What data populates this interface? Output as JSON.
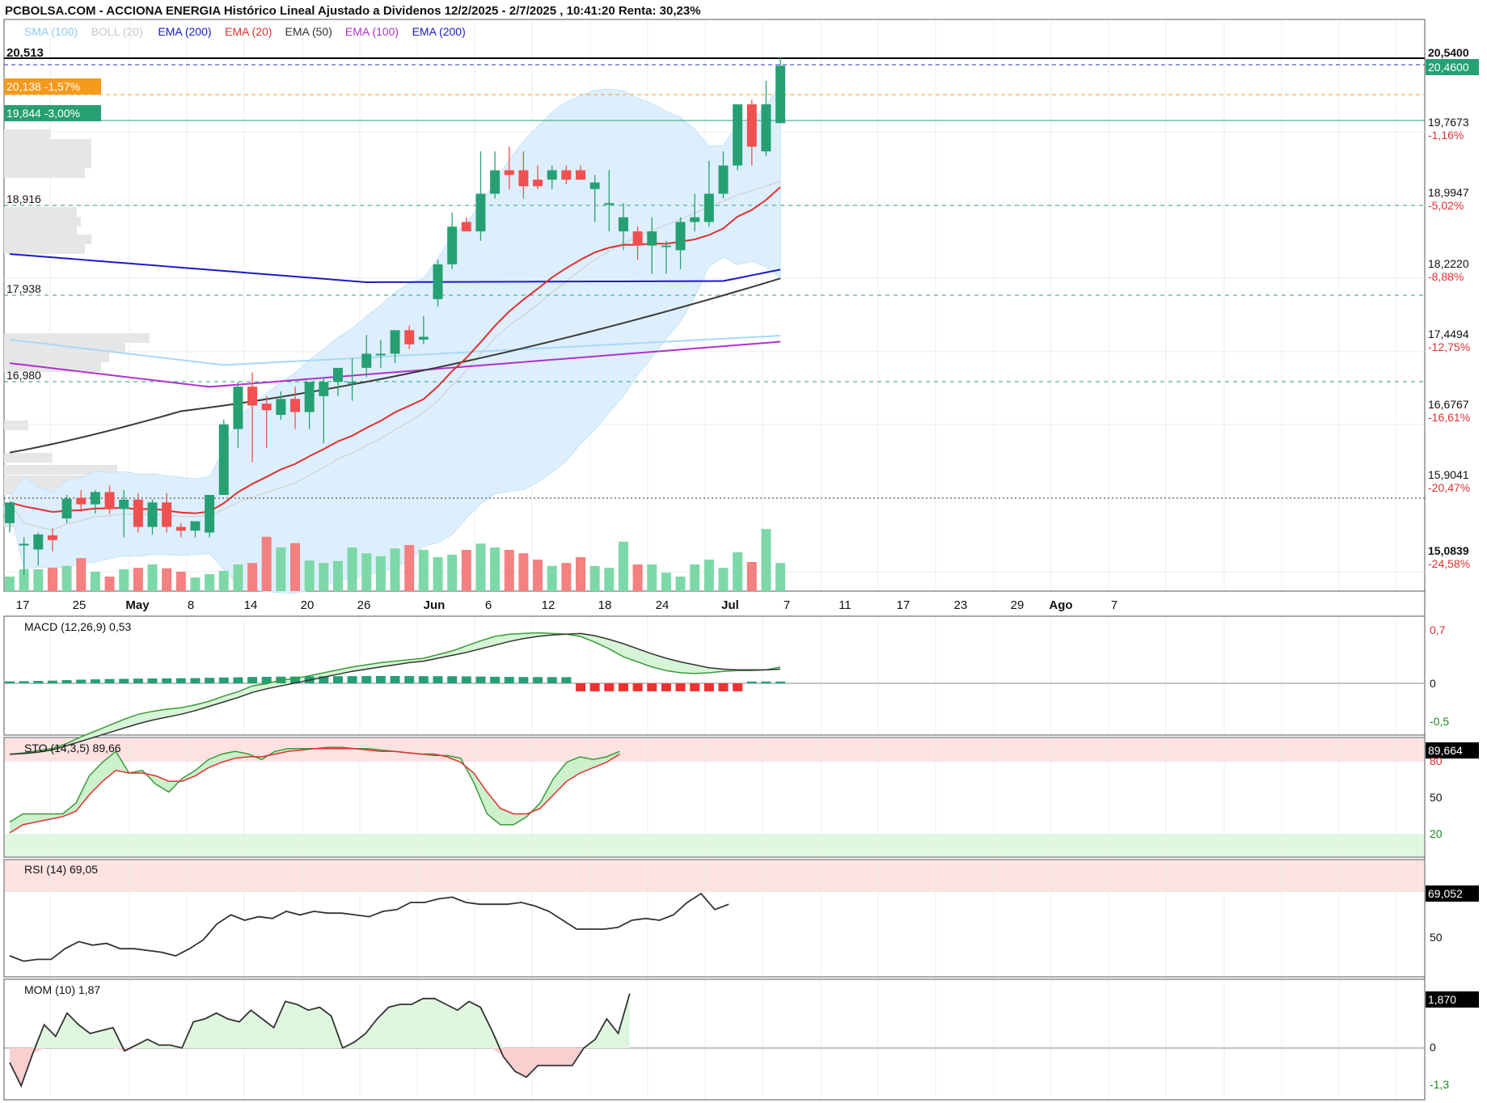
{
  "header": {
    "title": "PCBOLSA.COM - ACCIONA ENERGIA Histórico Lineal Ajustado a Dividenos 12/2/2025 - 2/7/2025 , 10:41:20 Renta: 30,23%",
    "legend": [
      {
        "label": "SMA (100)",
        "color": "#8fc9f0"
      },
      {
        "label": "BOLL (20)",
        "color": "#c8c8c8"
      },
      {
        "label": "EMA (200)",
        "color": "#1a1acc"
      },
      {
        "label": "EMA (20)",
        "color": "#e03030"
      },
      {
        "label": "EMA (50)",
        "color": "#333333"
      },
      {
        "label": "EMA (100)",
        "color": "#b030d0"
      },
      {
        "label": "EMA (200)",
        "color": "#1a1acc"
      }
    ]
  },
  "price_panel": {
    "max_label": "20,513",
    "badge_orange": "20,138 -1,57%",
    "badge_green": "19,844 -3,00%",
    "level_labels": [
      "18,916",
      "17,938",
      "16,980"
    ],
    "last_price": "20,4600",
    "axis_labels": [
      {
        "value": "20,5400",
        "pct": ""
      },
      {
        "value": "19,7673",
        "pct": "-1,16%"
      },
      {
        "value": "18,9947",
        "pct": "-5,02%"
      },
      {
        "value": "18,2220",
        "pct": "-8,88%"
      },
      {
        "value": "17,4494",
        "pct": "-12,75%"
      },
      {
        "value": "16,6767",
        "pct": "-16,61%"
      },
      {
        "value": "15,9041",
        "pct": "-20,47%"
      },
      {
        "value": "15,0839",
        "pct": "-24,58%"
      }
    ],
    "x_labels": [
      {
        "t": "17",
        "bold": false
      },
      {
        "t": "25",
        "bold": false
      },
      {
        "t": "May",
        "bold": true
      },
      {
        "t": "8",
        "bold": false
      },
      {
        "t": "14",
        "bold": false
      },
      {
        "t": "20",
        "bold": false
      },
      {
        "t": "26",
        "bold": false
      },
      {
        "t": "Jun",
        "bold": true
      },
      {
        "t": "6",
        "bold": false
      },
      {
        "t": "12",
        "bold": false
      },
      {
        "t": "18",
        "bold": false
      },
      {
        "t": "24",
        "bold": false
      },
      {
        "t": "Jul",
        "bold": true
      },
      {
        "t": "7",
        "bold": false
      },
      {
        "t": "11",
        "bold": false
      },
      {
        "t": "17",
        "bold": false
      },
      {
        "t": "23",
        "bold": false
      },
      {
        "t": "29",
        "bold": false
      },
      {
        "t": "Ago",
        "bold": true
      },
      {
        "t": "7",
        "bold": false
      }
    ]
  },
  "macd": {
    "label": "MACD (12,26,9)",
    "value": "0,53",
    "axis": [
      "0,7",
      "0",
      "-0,5"
    ]
  },
  "sto": {
    "label": "STO (14,3,5)",
    "value": "89,66",
    "last": "89,664",
    "axis": [
      "80",
      "50",
      "20"
    ]
  },
  "rsi": {
    "label": "RSI (14)",
    "value": "69,05",
    "last": "69,052",
    "axis": [
      "50"
    ]
  },
  "mom": {
    "label": "MOM (10)",
    "value": "1,87",
    "last": "1,870",
    "axis": [
      "0",
      "-1,3"
    ]
  },
  "colors": {
    "up": "#26a073",
    "down": "#f05050",
    "vol_up": "#7dd8a8",
    "vol_down": "#f48080"
  },
  "chart_data": {
    "type": "candlestick",
    "x": [
      "Apr 14",
      "Apr 15",
      "Apr 16",
      "Apr 17",
      "Apr 22",
      "Apr 23",
      "Apr 24",
      "Apr 25",
      "Apr 28",
      "Apr 29",
      "Apr 30",
      "May 2",
      "May 5",
      "May 6",
      "May 7",
      "May 8",
      "May 9",
      "May 12",
      "May 13",
      "May 14",
      "May 15",
      "May 16",
      "May 19",
      "May 20",
      "May 21",
      "May 22",
      "May 23",
      "May 26",
      "May 27",
      "May 28",
      "May 29",
      "May 30",
      "Jun 2",
      "Jun 3",
      "Jun 4",
      "Jun 5",
      "Jun 6",
      "Jun 9",
      "Jun 10",
      "Jun 11",
      "Jun 12",
      "Jun 13",
      "Jun 16",
      "Jun 17",
      "Jun 18",
      "Jun 19",
      "Jun 20",
      "Jun 23",
      "Jun 24",
      "Jun 25",
      "Jun 26",
      "Jun 27",
      "Jun 30",
      "Jul 1",
      "Jul 2"
    ],
    "open": [
      15.6,
      15.38,
      15.32,
      15.47,
      15.65,
      15.87,
      15.8,
      15.93,
      15.75,
      15.85,
      15.56,
      15.82,
      15.56,
      15.52,
      15.5,
      15.9,
      16.6,
      17.05,
      16.87,
      16.75,
      16.92,
      16.78,
      16.95,
      17.1,
      17.1,
      17.25,
      17.4,
      17.4,
      17.65,
      17.55,
      17.98,
      18.35,
      18.8,
      18.7,
      19.1,
      19.35,
      19.35,
      19.25,
      19.25,
      19.35,
      19.35,
      19.15,
      19.0,
      18.7,
      18.7,
      18.55,
      18.55,
      18.5,
      18.8,
      18.8,
      19.1,
      19.4,
      20.05,
      19.55,
      19.85
    ],
    "high": [
      15.75,
      15.45,
      15.5,
      15.55,
      15.9,
      15.95,
      15.95,
      16.0,
      15.95,
      15.92,
      15.85,
      15.92,
      15.6,
      15.6,
      15.9,
      16.7,
      17.1,
      17.2,
      16.95,
      17.0,
      17.05,
      17.05,
      17.15,
      17.25,
      17.35,
      17.6,
      17.55,
      17.65,
      17.7,
      17.8,
      18.4,
      18.9,
      18.85,
      19.55,
      19.55,
      19.6,
      19.55,
      19.4,
      19.4,
      19.4,
      19.4,
      19.3,
      19.35,
      19.0,
      18.75,
      18.85,
      18.6,
      18.85,
      19.1,
      19.45,
      19.55,
      20.05,
      20.1,
      20.3,
      20.55
    ],
    "high_note": "",
    "low": [
      15.5,
      15.05,
      15.15,
      15.3,
      15.6,
      15.72,
      15.7,
      15.7,
      15.45,
      15.5,
      15.48,
      15.5,
      15.45,
      15.45,
      15.45,
      15.9,
      16.4,
      16.25,
      16.4,
      16.7,
      16.6,
      16.6,
      16.45,
      16.95,
      16.9,
      17.15,
      17.25,
      17.3,
      17.45,
      17.5,
      17.9,
      18.3,
      18.7,
      18.6,
      19.05,
      19.15,
      19.05,
      19.15,
      19.15,
      19.2,
      19.25,
      18.8,
      18.7,
      18.5,
      18.4,
      18.25,
      18.25,
      18.3,
      18.7,
      18.75,
      19.05,
      19.35,
      19.4,
      19.5,
      19.85
    ],
    "close": [
      15.82,
      15.38,
      15.48,
      15.42,
      15.86,
      15.8,
      15.93,
      15.75,
      15.85,
      15.56,
      15.82,
      15.56,
      15.52,
      15.62,
      15.9,
      16.65,
      17.05,
      16.85,
      16.8,
      16.92,
      16.78,
      17.1,
      17.1,
      17.25,
      17.1,
      17.4,
      17.4,
      17.65,
      17.5,
      17.58,
      18.35,
      18.75,
      18.7,
      19.1,
      19.35,
      19.3,
      19.18,
      19.18,
      19.35,
      19.25,
      19.25,
      19.22,
      19.0,
      18.85,
      18.55,
      18.7,
      18.55,
      18.8,
      18.85,
      19.1,
      19.4,
      20.05,
      19.6,
      20.05,
      20.46
    ],
    "volume": [
      3.0,
      4.5,
      4.5,
      4.8,
      5.2,
      6.8,
      4.0,
      3.0,
      4.5,
      4.8,
      5.5,
      4.7,
      4.0,
      2.8,
      3.5,
      4.2,
      5.5,
      5.8,
      11.2,
      9.0,
      9.9,
      6.3,
      5.8,
      6.2,
      9.0,
      7.8,
      7.2,
      8.8,
      9.5,
      8.5,
      7.0,
      7.5,
      8.5,
      9.8,
      9.0,
      8.5,
      7.8,
      6.5,
      5.2,
      5.8,
      7.0,
      5.2,
      4.8,
      10.2,
      5.5,
      5.5,
      3.8,
      3.0,
      5.5,
      6.5,
      4.8,
      8.0,
      6.0,
      12.8,
      5.8,
      3.0
    ],
    "ylim": [
      14.9,
      20.55
    ],
    "xlim_dates": [
      "Apr 14",
      "Aug 8"
    ]
  }
}
